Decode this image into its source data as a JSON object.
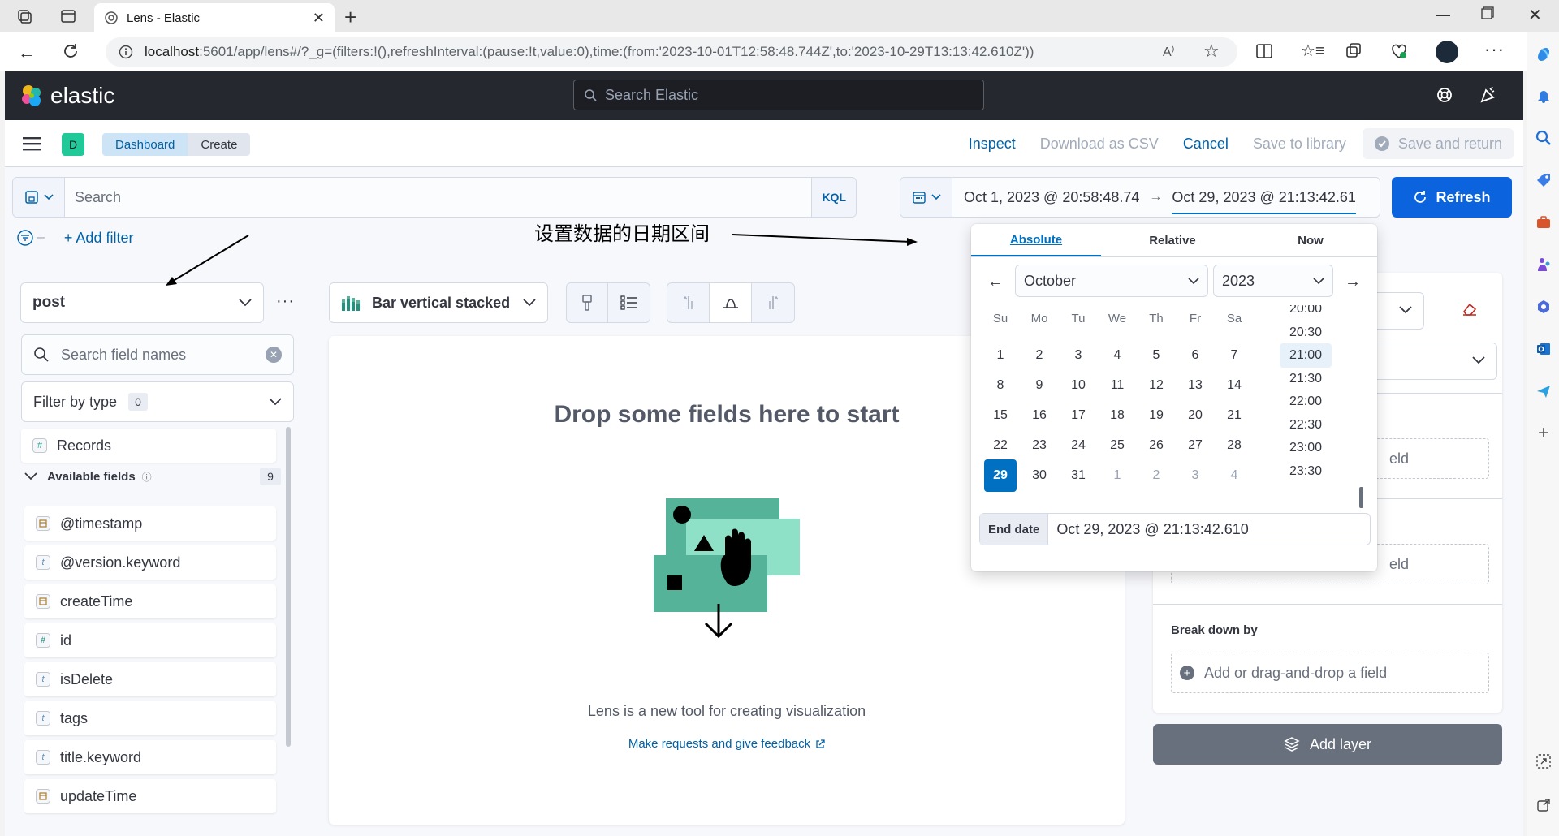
{
  "browser": {
    "tab_title": "Lens - Elastic",
    "url_host": "localhost",
    "url_rest": ":5601/app/lens#/?_g=(filters:!(),refreshInterval:(pause:!t,value:0),time:(from:'2023-10-01T12:58:48.744Z',to:'2023-10-29T13:13:42.610Z'))"
  },
  "kibana": {
    "brand": "elastic",
    "search_placeholder": "Search Elastic",
    "space_initial": "D",
    "breadcrumbs": [
      "Dashboard",
      "Create"
    ],
    "actions": {
      "inspect": "Inspect",
      "download": "Download as CSV",
      "cancel": "Cancel",
      "save_library": "Save to library",
      "save_return": "Save and return"
    }
  },
  "query": {
    "search_placeholder": "Search",
    "language": "KQL",
    "start_date": "Oct 1, 2023 @ 20:58:48.74",
    "end_date": "Oct 29, 2023 @ 21:13:42.61",
    "refresh_label": "Refresh",
    "add_filter": "+ Add filter"
  },
  "annotation": {
    "text": "设置数据的日期区间"
  },
  "left_panel": {
    "index_pattern": "post",
    "field_search_placeholder": "Search field names",
    "filter_by_type": "Filter by type",
    "filter_count": "0",
    "records_label": "Records",
    "available_fields_label": "Available fields",
    "available_count": "9",
    "fields": [
      {
        "name": "@timestamp",
        "type": "date"
      },
      {
        "name": "@version.keyword",
        "type": "t"
      },
      {
        "name": "createTime",
        "type": "date"
      },
      {
        "name": "id",
        "type": "#"
      },
      {
        "name": "isDelete",
        "type": "t"
      },
      {
        "name": "tags",
        "type": "t"
      },
      {
        "name": "title.keyword",
        "type": "t"
      },
      {
        "name": "updateTime",
        "type": "date"
      }
    ]
  },
  "workspace": {
    "chart_type": "Bar vertical stacked",
    "drop_title": "Drop some fields here to start",
    "description": "Lens is a new tool for creating visualization",
    "feedback_link": "Make requests and give feedback"
  },
  "right_panel": {
    "field_suffix_1": "eld",
    "field_suffix_2": "eld",
    "breakdown_label": "Break down by",
    "add_field": "Add or drag-and-drop a field",
    "add_layer": "Add layer"
  },
  "date_picker": {
    "tabs": [
      "Absolute",
      "Relative",
      "Now"
    ],
    "month": "October",
    "year": "2023",
    "weekdays": [
      "Su",
      "Mo",
      "Tu",
      "We",
      "Th",
      "Fr",
      "Sa"
    ],
    "weeks": [
      [
        "1",
        "2",
        "3",
        "4",
        "5",
        "6",
        "7"
      ],
      [
        "8",
        "9",
        "10",
        "11",
        "12",
        "13",
        "14"
      ],
      [
        "15",
        "16",
        "17",
        "18",
        "19",
        "20",
        "21"
      ],
      [
        "22",
        "23",
        "24",
        "25",
        "26",
        "27",
        "28"
      ],
      [
        "29",
        "30",
        "31",
        "1",
        "2",
        "3",
        "4"
      ]
    ],
    "selected_day": "29",
    "times": [
      "20:00",
      "20:30",
      "21:00",
      "21:30",
      "22:00",
      "22:30",
      "23:00",
      "23:30"
    ],
    "selected_time": "21:00",
    "end_label": "End date",
    "end_value": "Oct 29, 2023 @ 21:13:42.610"
  },
  "colors": {
    "accent": "#0071c2",
    "refresh_bg": "#0b64dd",
    "header_bg": "#25282f",
    "add_layer_bg": "#69707d"
  }
}
